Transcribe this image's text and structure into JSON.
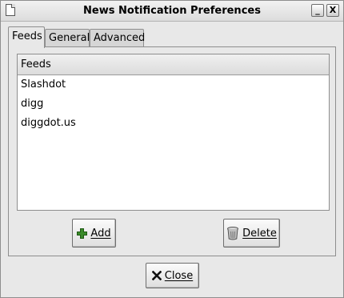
{
  "window": {
    "title": "News Notification Preferences"
  },
  "titlebar_buttons": {
    "minimize": "_",
    "close": "X"
  },
  "tabs": [
    {
      "label": "Feeds",
      "active": true
    },
    {
      "label": "General",
      "active": false
    },
    {
      "label": "Advanced",
      "active": false
    }
  ],
  "feeds": {
    "column_header": "Feeds",
    "items": [
      "Slashdot",
      "digg",
      "diggdot.us"
    ]
  },
  "buttons": {
    "add": {
      "label": "Add",
      "icon": "plus-icon"
    },
    "delete": {
      "label": "Delete",
      "icon": "trash-icon"
    },
    "close": {
      "label": "Close",
      "icon": "close-x-icon"
    }
  },
  "colors": {
    "add_icon": "#3a8a2a",
    "window_bg": "#e8e8e8"
  }
}
